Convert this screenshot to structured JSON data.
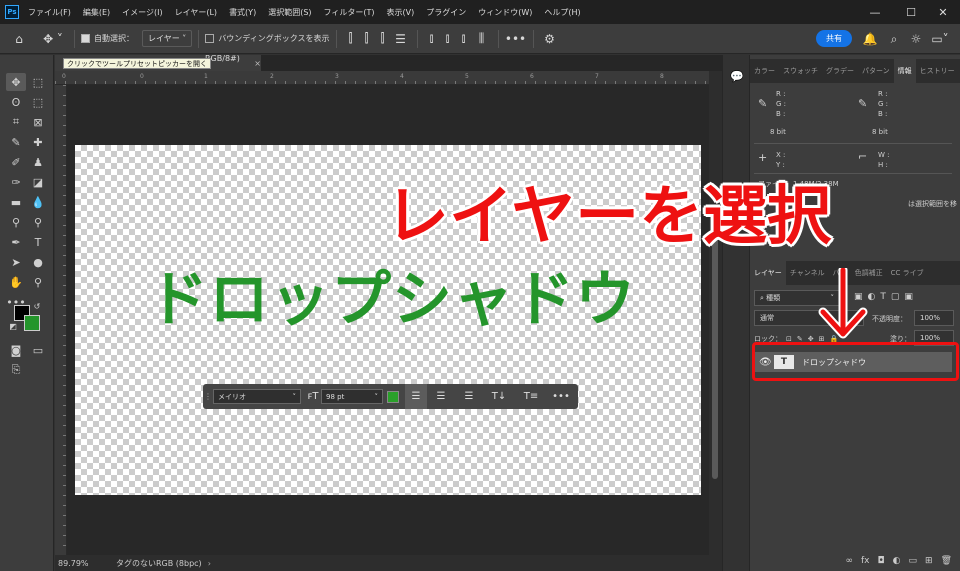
{
  "app": {
    "logo": "Ps"
  },
  "menu": [
    "ファイル(F)",
    "編集(E)",
    "イメージ(I)",
    "レイヤー(L)",
    "書式(Y)",
    "選択範囲(S)",
    "フィルター(T)",
    "表示(V)",
    "プラグイン",
    "ウィンドウ(W)",
    "ヘルプ(H)"
  ],
  "window_controls": {
    "minimize": "—",
    "maximize": "☐",
    "close": "✕"
  },
  "options": {
    "auto_select_label": "自動選択：",
    "auto_select_value": "レイヤー",
    "bounding_box_label": "バウンディングボックスを表示",
    "more": "•••",
    "share": "共有"
  },
  "tooltip": "クリックでツールプリセットピッカーを開く",
  "document": {
    "tab_title": "RGB/8#) *",
    "close": "×"
  },
  "ruler_labels": [
    "0",
    "0",
    "1",
    "2",
    "3",
    "4",
    "5",
    "6",
    "7",
    "8"
  ],
  "canvas": {
    "text": "ドロップシャドウ",
    "text_color": "#24952b"
  },
  "text_bar": {
    "font": "メイリオ",
    "size": "98 pt",
    "color": "#2aa02a"
  },
  "status": {
    "zoom": "89.79%",
    "info": "タグのないRGB (8bpc)"
  },
  "info_panel": {
    "tabs": [
      "カラー",
      "スウォッチ",
      "グラデー",
      "パターン",
      "情報",
      "ヒストリー"
    ],
    "active_tab": "情報",
    "rgb_left": [
      "R :",
      "G :",
      "B :"
    ],
    "rgb_right": [
      "R :",
      "G :",
      "B :"
    ],
    "bit_left": "8 bit",
    "bit_right": "8 bit",
    "xy": [
      "X :",
      "Y :"
    ],
    "wh": [
      "W :",
      "H :"
    ],
    "file": "ファイル：1.48M/2.38M",
    "hint": "は選択範囲を移"
  },
  "layers_panel": {
    "tabs": [
      "レイヤー",
      "チャンネル",
      "パス",
      "色調補正",
      "CC ライブ"
    ],
    "kind": "種類",
    "blend_mode": "通常",
    "opacity_label": "不透明度：",
    "opacity": "100%",
    "lock_label": "ロック：",
    "fill_label": "塗り：",
    "fill": "100%",
    "layer_name": "ドロップシャドウ",
    "layer_thumb": "T",
    "bottom_icons": [
      "fx",
      "◘",
      "◐",
      "▭",
      "⊞",
      "🗑"
    ]
  },
  "annotation": {
    "text": "レイヤーを選択",
    "color": "#ee1111"
  }
}
